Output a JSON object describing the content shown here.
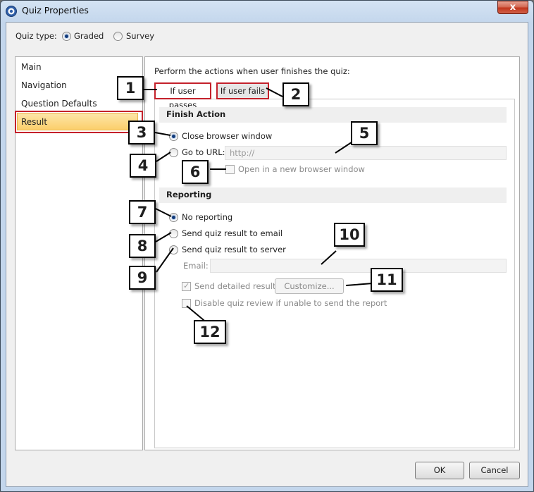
{
  "window": {
    "title": "Quiz Properties",
    "close_label": "x"
  },
  "quiz_type": {
    "label": "Quiz type:",
    "options": [
      {
        "label": "Graded",
        "selected": true
      },
      {
        "label": "Survey",
        "selected": false
      }
    ]
  },
  "nav": {
    "items": [
      {
        "label": "Main"
      },
      {
        "label": "Navigation"
      },
      {
        "label": "Question Defaults"
      },
      {
        "label": "Result",
        "selected": true
      }
    ]
  },
  "main": {
    "instruction": "Perform the actions when user finishes the quiz:",
    "tabs": [
      {
        "label": "If user passes",
        "active": true
      },
      {
        "label": "If user fails",
        "active": false
      }
    ],
    "finish_action": {
      "header": "Finish Action",
      "close_browser": "Close browser window",
      "go_to_url": "Go to URL:",
      "url_placeholder": "http://",
      "open_new_window": "Open in a new browser window"
    },
    "reporting": {
      "header": "Reporting",
      "no_reporting": "No reporting",
      "send_email": "Send quiz result to email",
      "send_server": "Send quiz result to server",
      "email_label": "Email:",
      "send_detailed": "Send detailed results",
      "customize": "Customize...",
      "disable_review": "Disable quiz review if unable to send the report"
    }
  },
  "footer": {
    "ok": "OK",
    "cancel": "Cancel"
  },
  "callouts": [
    "1",
    "2",
    "3",
    "4",
    "5",
    "6",
    "7",
    "8",
    "9",
    "10",
    "11",
    "12"
  ],
  "colors": {
    "highlight_border": "#c4212b",
    "selected_nav": "#fbcf6b",
    "titlebar": "#c3d6ec"
  }
}
